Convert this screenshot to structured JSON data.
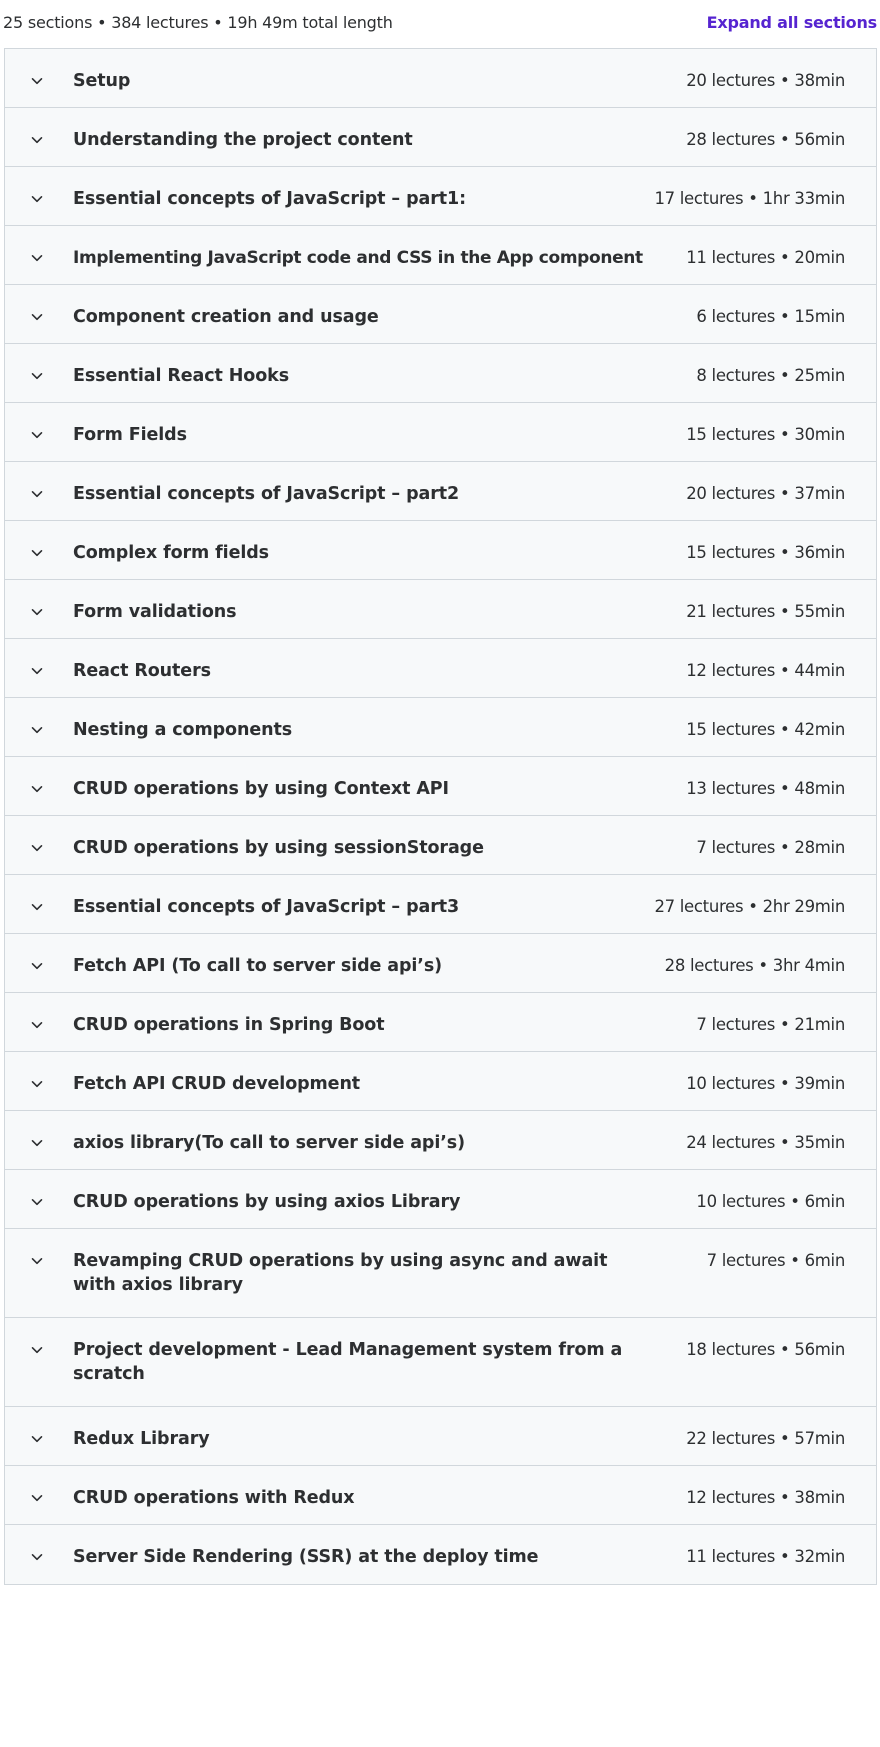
{
  "summary": {
    "text": "25 sections • 384 lectures • 19h 49m total length",
    "expand_label": "Expand all sections"
  },
  "icons": {
    "chevron": "chevron-down-icon"
  },
  "colors": {
    "accent": "#5624d0",
    "row_background": "#f7f9fa",
    "border": "#d1d7dc",
    "text": "#2d2f31"
  },
  "sections": [
    {
      "title": "Setup",
      "meta": "20 lectures • 38min"
    },
    {
      "title": "Understanding the project content",
      "meta": "28 lectures • 56min"
    },
    {
      "title": "Essential concepts of JavaScript – part1:",
      "meta": "17 lectures • 1hr 33min"
    },
    {
      "title": "Implementing JavaScript code and CSS in the App component",
      "meta": "11 lectures • 20min"
    },
    {
      "title": "Component creation and usage",
      "meta": "6 lectures • 15min"
    },
    {
      "title": "Essential React Hooks",
      "meta": "8 lectures • 25min"
    },
    {
      "title": "Form Fields",
      "meta": "15 lectures • 30min"
    },
    {
      "title": "Essential concepts of JavaScript – part2",
      "meta": "20 lectures • 37min"
    },
    {
      "title": "Complex form fields",
      "meta": "15 lectures • 36min"
    },
    {
      "title": "Form validations",
      "meta": "21 lectures • 55min"
    },
    {
      "title": "React Routers",
      "meta": "12 lectures • 44min"
    },
    {
      "title": "Nesting a components",
      "meta": "15 lectures • 42min"
    },
    {
      "title": "CRUD operations by using Context API",
      "meta": "13 lectures • 48min"
    },
    {
      "title": "CRUD operations by using sessionStorage",
      "meta": "7 lectures • 28min"
    },
    {
      "title": "Essential concepts of JavaScript – part3",
      "meta": "27 lectures • 2hr 29min"
    },
    {
      "title": "Fetch API (To call to server side api’s)",
      "meta": "28 lectures • 3hr 4min"
    },
    {
      "title": "CRUD operations in Spring Boot",
      "meta": "7 lectures • 21min"
    },
    {
      "title": "Fetch API CRUD development",
      "meta": "10 lectures • 39min"
    },
    {
      "title": "axios library(To call to server side api’s)",
      "meta": "24 lectures • 35min"
    },
    {
      "title": "CRUD operations by using axios Library",
      "meta": "10 lectures • 6min"
    },
    {
      "title": "Revamping CRUD operations by using async and await with axios library",
      "meta": "7 lectures • 6min"
    },
    {
      "title": "Project development - Lead Management system from a scratch",
      "meta": "18 lectures • 56min"
    },
    {
      "title": "Redux Library",
      "meta": "22 lectures • 57min"
    },
    {
      "title": "CRUD operations with Redux",
      "meta": "12 lectures • 38min"
    },
    {
      "title": "Server Side Rendering (SSR) at the deploy time",
      "meta": "11 lectures • 32min"
    }
  ]
}
